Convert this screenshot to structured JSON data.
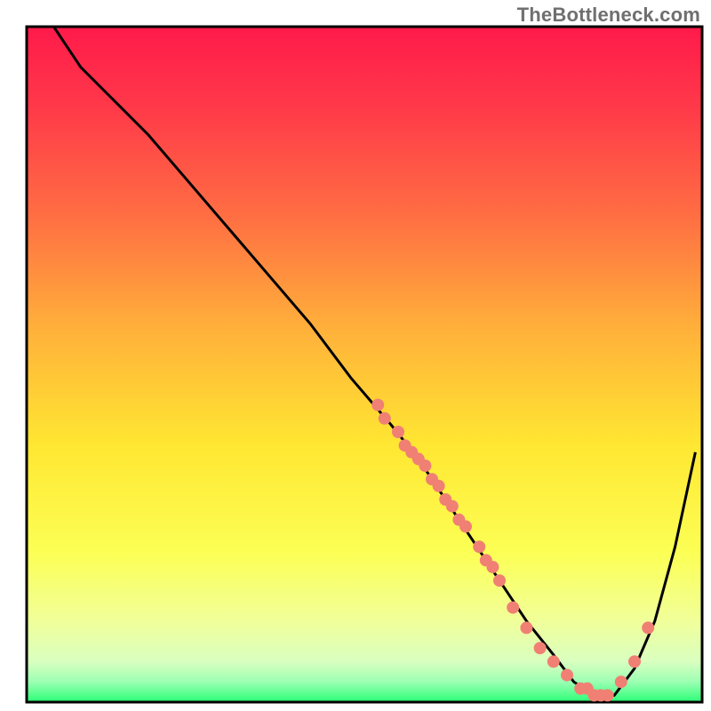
{
  "watermark": "TheBottleneck.com",
  "chart_data": {
    "type": "line",
    "title": "",
    "xlabel": "",
    "ylabel": "",
    "xlim": [
      0,
      100
    ],
    "ylim": [
      0,
      100
    ],
    "gradient_stops": [
      {
        "pct": 0,
        "color": "#ff1a4b"
      },
      {
        "pct": 12,
        "color": "#ff3949"
      },
      {
        "pct": 28,
        "color": "#ff6e43"
      },
      {
        "pct": 45,
        "color": "#ffb13a"
      },
      {
        "pct": 62,
        "color": "#ffe732"
      },
      {
        "pct": 78,
        "color": "#fcff55"
      },
      {
        "pct": 88,
        "color": "#f1ff9a"
      },
      {
        "pct": 94,
        "color": "#d9ffc0"
      },
      {
        "pct": 97,
        "color": "#9cffb3"
      },
      {
        "pct": 100,
        "color": "#29ff76"
      }
    ],
    "series": [
      {
        "name": "curve",
        "type": "line",
        "color": "#000000",
        "x": [
          4,
          6,
          8,
          12,
          18,
          24,
          30,
          36,
          42,
          48,
          54,
          58,
          62,
          66,
          70,
          74,
          78,
          81,
          84,
          87,
          90,
          93,
          96,
          99
        ],
        "y": [
          100,
          97,
          94,
          90,
          84,
          77,
          70,
          63,
          56,
          48,
          41,
          36,
          30,
          24,
          18,
          12,
          7,
          3,
          1,
          1,
          5,
          12,
          23,
          37
        ]
      },
      {
        "name": "points",
        "type": "scatter",
        "color": "#f08074",
        "x": [
          52,
          53,
          55,
          56,
          57,
          58,
          59,
          60,
          61,
          62,
          63,
          64,
          65,
          67,
          68,
          69,
          70,
          72,
          74,
          76,
          78,
          80,
          82,
          83,
          84,
          85,
          86,
          88,
          90,
          92
        ],
        "y": [
          44,
          42,
          40,
          38,
          37,
          36,
          35,
          33,
          32,
          30,
          29,
          27,
          26,
          23,
          21,
          20,
          18,
          14,
          11,
          8,
          6,
          4,
          2,
          2,
          1,
          1,
          1,
          3,
          6,
          11
        ]
      }
    ]
  }
}
